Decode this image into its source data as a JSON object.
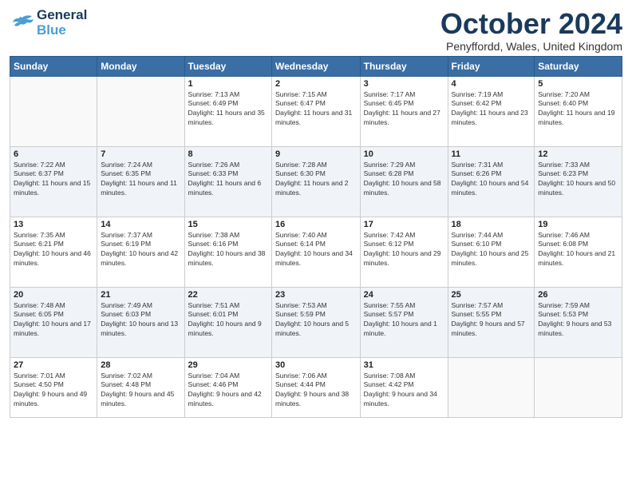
{
  "logo": {
    "line1": "General",
    "line2": "Blue"
  },
  "title": "October 2024",
  "location": "Penyffordd, Wales, United Kingdom",
  "days_of_week": [
    "Sunday",
    "Monday",
    "Tuesday",
    "Wednesday",
    "Thursday",
    "Friday",
    "Saturday"
  ],
  "weeks": [
    [
      {
        "day": "",
        "sunrise": "",
        "sunset": "",
        "daylight": ""
      },
      {
        "day": "",
        "sunrise": "",
        "sunset": "",
        "daylight": ""
      },
      {
        "day": "1",
        "sunrise": "Sunrise: 7:13 AM",
        "sunset": "Sunset: 6:49 PM",
        "daylight": "Daylight: 11 hours and 35 minutes."
      },
      {
        "day": "2",
        "sunrise": "Sunrise: 7:15 AM",
        "sunset": "Sunset: 6:47 PM",
        "daylight": "Daylight: 11 hours and 31 minutes."
      },
      {
        "day": "3",
        "sunrise": "Sunrise: 7:17 AM",
        "sunset": "Sunset: 6:45 PM",
        "daylight": "Daylight: 11 hours and 27 minutes."
      },
      {
        "day": "4",
        "sunrise": "Sunrise: 7:19 AM",
        "sunset": "Sunset: 6:42 PM",
        "daylight": "Daylight: 11 hours and 23 minutes."
      },
      {
        "day": "5",
        "sunrise": "Sunrise: 7:20 AM",
        "sunset": "Sunset: 6:40 PM",
        "daylight": "Daylight: 11 hours and 19 minutes."
      }
    ],
    [
      {
        "day": "6",
        "sunrise": "Sunrise: 7:22 AM",
        "sunset": "Sunset: 6:37 PM",
        "daylight": "Daylight: 11 hours and 15 minutes."
      },
      {
        "day": "7",
        "sunrise": "Sunrise: 7:24 AM",
        "sunset": "Sunset: 6:35 PM",
        "daylight": "Daylight: 11 hours and 11 minutes."
      },
      {
        "day": "8",
        "sunrise": "Sunrise: 7:26 AM",
        "sunset": "Sunset: 6:33 PM",
        "daylight": "Daylight: 11 hours and 6 minutes."
      },
      {
        "day": "9",
        "sunrise": "Sunrise: 7:28 AM",
        "sunset": "Sunset: 6:30 PM",
        "daylight": "Daylight: 11 hours and 2 minutes."
      },
      {
        "day": "10",
        "sunrise": "Sunrise: 7:29 AM",
        "sunset": "Sunset: 6:28 PM",
        "daylight": "Daylight: 10 hours and 58 minutes."
      },
      {
        "day": "11",
        "sunrise": "Sunrise: 7:31 AM",
        "sunset": "Sunset: 6:26 PM",
        "daylight": "Daylight: 10 hours and 54 minutes."
      },
      {
        "day": "12",
        "sunrise": "Sunrise: 7:33 AM",
        "sunset": "Sunset: 6:23 PM",
        "daylight": "Daylight: 10 hours and 50 minutes."
      }
    ],
    [
      {
        "day": "13",
        "sunrise": "Sunrise: 7:35 AM",
        "sunset": "Sunset: 6:21 PM",
        "daylight": "Daylight: 10 hours and 46 minutes."
      },
      {
        "day": "14",
        "sunrise": "Sunrise: 7:37 AM",
        "sunset": "Sunset: 6:19 PM",
        "daylight": "Daylight: 10 hours and 42 minutes."
      },
      {
        "day": "15",
        "sunrise": "Sunrise: 7:38 AM",
        "sunset": "Sunset: 6:16 PM",
        "daylight": "Daylight: 10 hours and 38 minutes."
      },
      {
        "day": "16",
        "sunrise": "Sunrise: 7:40 AM",
        "sunset": "Sunset: 6:14 PM",
        "daylight": "Daylight: 10 hours and 34 minutes."
      },
      {
        "day": "17",
        "sunrise": "Sunrise: 7:42 AM",
        "sunset": "Sunset: 6:12 PM",
        "daylight": "Daylight: 10 hours and 29 minutes."
      },
      {
        "day": "18",
        "sunrise": "Sunrise: 7:44 AM",
        "sunset": "Sunset: 6:10 PM",
        "daylight": "Daylight: 10 hours and 25 minutes."
      },
      {
        "day": "19",
        "sunrise": "Sunrise: 7:46 AM",
        "sunset": "Sunset: 6:08 PM",
        "daylight": "Daylight: 10 hours and 21 minutes."
      }
    ],
    [
      {
        "day": "20",
        "sunrise": "Sunrise: 7:48 AM",
        "sunset": "Sunset: 6:05 PM",
        "daylight": "Daylight: 10 hours and 17 minutes."
      },
      {
        "day": "21",
        "sunrise": "Sunrise: 7:49 AM",
        "sunset": "Sunset: 6:03 PM",
        "daylight": "Daylight: 10 hours and 13 minutes."
      },
      {
        "day": "22",
        "sunrise": "Sunrise: 7:51 AM",
        "sunset": "Sunset: 6:01 PM",
        "daylight": "Daylight: 10 hours and 9 minutes."
      },
      {
        "day": "23",
        "sunrise": "Sunrise: 7:53 AM",
        "sunset": "Sunset: 5:59 PM",
        "daylight": "Daylight: 10 hours and 5 minutes."
      },
      {
        "day": "24",
        "sunrise": "Sunrise: 7:55 AM",
        "sunset": "Sunset: 5:57 PM",
        "daylight": "Daylight: 10 hours and 1 minute."
      },
      {
        "day": "25",
        "sunrise": "Sunrise: 7:57 AM",
        "sunset": "Sunset: 5:55 PM",
        "daylight": "Daylight: 9 hours and 57 minutes."
      },
      {
        "day": "26",
        "sunrise": "Sunrise: 7:59 AM",
        "sunset": "Sunset: 5:53 PM",
        "daylight": "Daylight: 9 hours and 53 minutes."
      }
    ],
    [
      {
        "day": "27",
        "sunrise": "Sunrise: 7:01 AM",
        "sunset": "Sunset: 4:50 PM",
        "daylight": "Daylight: 9 hours and 49 minutes."
      },
      {
        "day": "28",
        "sunrise": "Sunrise: 7:02 AM",
        "sunset": "Sunset: 4:48 PM",
        "daylight": "Daylight: 9 hours and 45 minutes."
      },
      {
        "day": "29",
        "sunrise": "Sunrise: 7:04 AM",
        "sunset": "Sunset: 4:46 PM",
        "daylight": "Daylight: 9 hours and 42 minutes."
      },
      {
        "day": "30",
        "sunrise": "Sunrise: 7:06 AM",
        "sunset": "Sunset: 4:44 PM",
        "daylight": "Daylight: 9 hours and 38 minutes."
      },
      {
        "day": "31",
        "sunrise": "Sunrise: 7:08 AM",
        "sunset": "Sunset: 4:42 PM",
        "daylight": "Daylight: 9 hours and 34 minutes."
      },
      {
        "day": "",
        "sunrise": "",
        "sunset": "",
        "daylight": ""
      },
      {
        "day": "",
        "sunrise": "",
        "sunset": "",
        "daylight": ""
      }
    ]
  ]
}
